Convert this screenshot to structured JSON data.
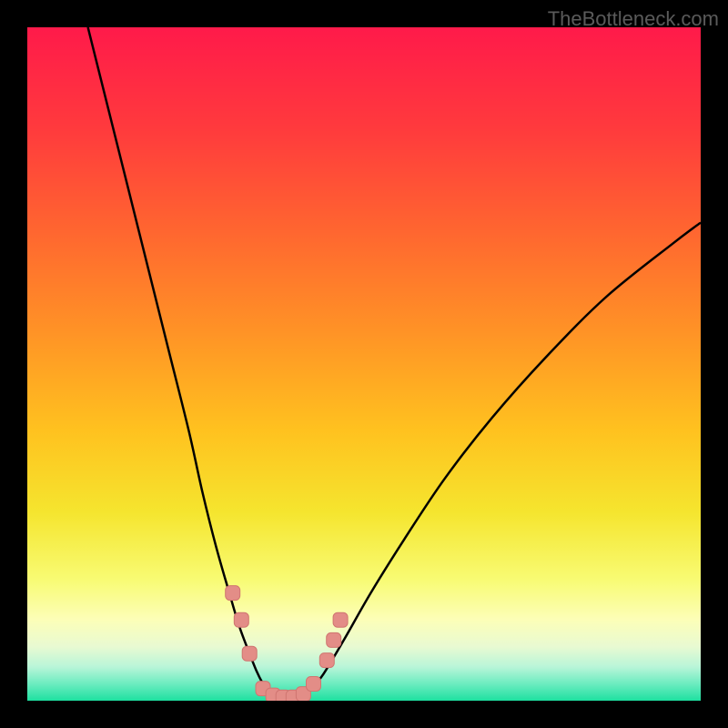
{
  "watermark": "TheBottleneck.com",
  "chart_data": {
    "type": "line",
    "title": "",
    "xlabel": "",
    "ylabel": "",
    "xlim": [
      0,
      100
    ],
    "ylim": [
      0,
      100
    ],
    "gradient_stops": [
      {
        "offset": 0,
        "color": "#ff1a4a"
      },
      {
        "offset": 15,
        "color": "#ff3a3d"
      },
      {
        "offset": 30,
        "color": "#ff6530"
      },
      {
        "offset": 45,
        "color": "#ff9226"
      },
      {
        "offset": 60,
        "color": "#ffc21f"
      },
      {
        "offset": 72,
        "color": "#f5e52e"
      },
      {
        "offset": 82,
        "color": "#f8fb73"
      },
      {
        "offset": 88,
        "color": "#fcfeb8"
      },
      {
        "offset": 92,
        "color": "#e8fad2"
      },
      {
        "offset": 95,
        "color": "#b8f5d8"
      },
      {
        "offset": 97.5,
        "color": "#6cecc0"
      },
      {
        "offset": 100,
        "color": "#1ee0a0"
      }
    ],
    "series": [
      {
        "name": "left-curve",
        "x": [
          9,
          12,
          15,
          18,
          21,
          24,
          26,
          28,
          30,
          31.5,
          33,
          34,
          35,
          36,
          37
        ],
        "y": [
          100,
          88,
          76,
          64,
          52,
          40,
          31,
          23,
          16,
          11,
          7,
          4.5,
          2.5,
          1,
          0.3
        ]
      },
      {
        "name": "right-curve",
        "x": [
          41,
          42,
          44,
          47,
          51,
          56,
          62,
          69,
          77,
          86,
          96,
          100
        ],
        "y": [
          0.3,
          1.5,
          4,
          9,
          16,
          24,
          33,
          42,
          51,
          60,
          68,
          71
        ]
      }
    ],
    "markers": [
      {
        "x": 30.5,
        "y": 16
      },
      {
        "x": 31.8,
        "y": 12
      },
      {
        "x": 33,
        "y": 7
      },
      {
        "x": 35,
        "y": 1.8
      },
      {
        "x": 36.5,
        "y": 0.8
      },
      {
        "x": 38,
        "y": 0.5
      },
      {
        "x": 39.5,
        "y": 0.5
      },
      {
        "x": 41,
        "y": 1
      },
      {
        "x": 42.5,
        "y": 2.5
      },
      {
        "x": 44.5,
        "y": 6
      },
      {
        "x": 45.5,
        "y": 9
      },
      {
        "x": 46.5,
        "y": 12
      }
    ]
  }
}
